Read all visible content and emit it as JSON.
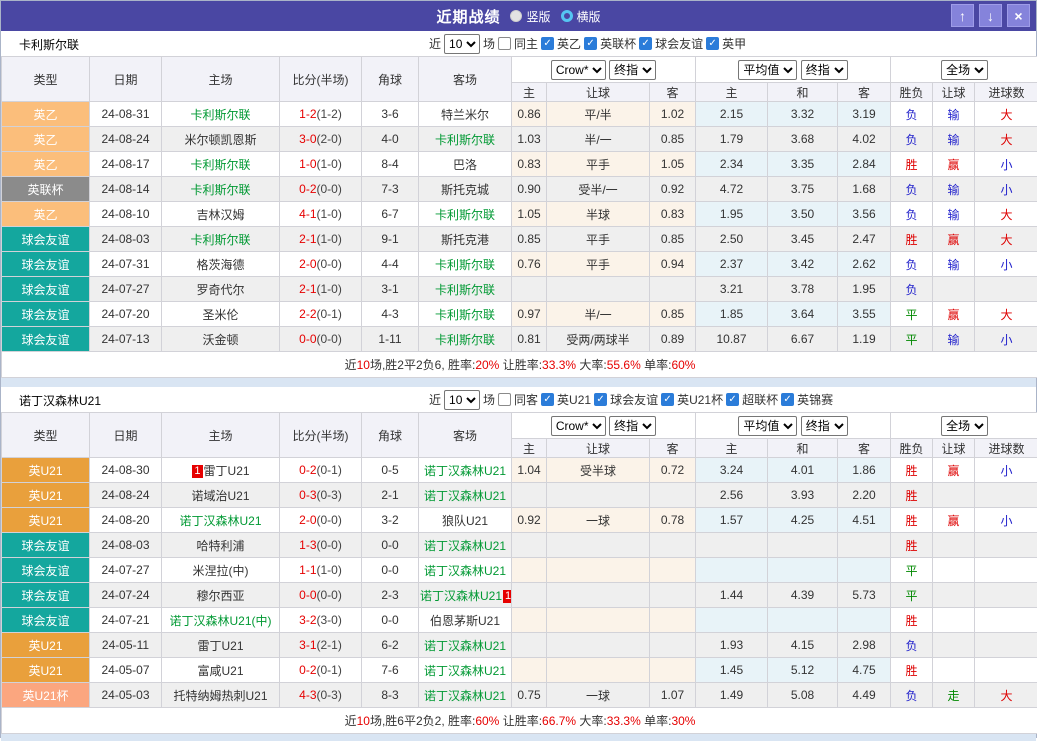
{
  "titlebar": {
    "title": "近期战绩",
    "vertical_label": "竖版",
    "horizontal_label": "横版",
    "up_glyph": "↑",
    "down_glyph": "↓",
    "close_glyph": "×"
  },
  "table_header": {
    "type": "类型",
    "date": "日期",
    "home": "主场",
    "score": "比分(半场)",
    "corner": "角球",
    "away": "客场",
    "odds_group": {
      "provider_dropdown": "Crow*",
      "time_dropdown": "终指",
      "sub": [
        "主",
        "让球",
        "客"
      ]
    },
    "avg_group": {
      "value_dropdown": "平均值",
      "time_dropdown": "终指",
      "sub": [
        "主",
        "和",
        "客"
      ]
    },
    "result_group": {
      "scope_dropdown": "全场",
      "sub": [
        "胜负",
        "让球",
        "进球数"
      ]
    }
  },
  "type_colors": {
    "英乙": "#fbbe7b",
    "英联杯": "#8b8b8b",
    "球会友谊": "#14a79e",
    "英U21": "#e9a03c",
    "英U21杯": "#fba67f"
  },
  "result_colors": {
    "胜": "#de0000",
    "赢": "#de0000",
    "大": "#de0000",
    "负": "#2222cc",
    "输": "#2222cc",
    "小": "#2222cc",
    "平": "#008800",
    "走": "#008800"
  },
  "sections": [
    {
      "team": "卡利斯尔联",
      "filter": {
        "near": "近",
        "count": "10",
        "games": "场",
        "same": "同主",
        "leagues": [
          "英乙",
          "英联杯",
          "球会友谊",
          "英甲"
        ]
      },
      "rows": [
        {
          "type": "英乙",
          "date": "24-08-31",
          "home": "卡利斯尔联",
          "hg": true,
          "score": "1-2",
          "half": "(1-2)",
          "corner": "3-6",
          "away": "特兰米尔",
          "ag": false,
          "o1": "0.86",
          "hc": "平/半",
          "o2": "1.02",
          "a1": "2.15",
          "a2": "3.32",
          "a3": "3.19",
          "r1": "负",
          "r2": "输",
          "r3": "大"
        },
        {
          "type": "英乙",
          "date": "24-08-24",
          "home": "米尔顿凯恩斯",
          "hg": false,
          "score": "3-0",
          "half": "(2-0)",
          "corner": "4-0",
          "away": "卡利斯尔联",
          "ag": true,
          "o1": "1.03",
          "hc": "半/一",
          "o2": "0.85",
          "a1": "1.79",
          "a2": "3.68",
          "a3": "4.02",
          "r1": "负",
          "r2": "输",
          "r3": "大"
        },
        {
          "type": "英乙",
          "date": "24-08-17",
          "home": "卡利斯尔联",
          "hg": true,
          "score": "1-0",
          "half": "(1-0)",
          "corner": "8-4",
          "away": "巴洛",
          "ag": false,
          "o1": "0.83",
          "hc": "平手",
          "o2": "1.05",
          "a1": "2.34",
          "a2": "3.35",
          "a3": "2.84",
          "r1": "胜",
          "r2": "赢",
          "r3": "小"
        },
        {
          "type": "英联杯",
          "date": "24-08-14",
          "home": "卡利斯尔联",
          "hg": true,
          "score": "0-2",
          "half": "(0-0)",
          "corner": "7-3",
          "away": "斯托克城",
          "ag": false,
          "o1": "0.90",
          "hc": "受半/一",
          "o2": "0.92",
          "a1": "4.72",
          "a2": "3.75",
          "a3": "1.68",
          "r1": "负",
          "r2": "输",
          "r3": "小"
        },
        {
          "type": "英乙",
          "date": "24-08-10",
          "home": "吉林汉姆",
          "hg": false,
          "score": "4-1",
          "half": "(1-0)",
          "corner": "6-7",
          "away": "卡利斯尔联",
          "ag": true,
          "o1": "1.05",
          "hc": "半球",
          "o2": "0.83",
          "a1": "1.95",
          "a2": "3.50",
          "a3": "3.56",
          "r1": "负",
          "r2": "输",
          "r3": "大"
        },
        {
          "type": "球会友谊",
          "date": "24-08-03",
          "home": "卡利斯尔联",
          "hg": true,
          "score": "2-1",
          "half": "(1-0)",
          "corner": "9-1",
          "away": "斯托克港",
          "ag": false,
          "o1": "0.85",
          "hc": "平手",
          "o2": "0.85",
          "a1": "2.50",
          "a2": "3.45",
          "a3": "2.47",
          "r1": "胜",
          "r2": "赢",
          "r3": "大"
        },
        {
          "type": "球会友谊",
          "date": "24-07-31",
          "home": "格茨海德",
          "hg": false,
          "score": "2-0",
          "half": "(0-0)",
          "corner": "4-4",
          "away": "卡利斯尔联",
          "ag": true,
          "o1": "0.76",
          "hc": "平手",
          "o2": "0.94",
          "a1": "2.37",
          "a2": "3.42",
          "a3": "2.62",
          "r1": "负",
          "r2": "输",
          "r3": "小"
        },
        {
          "type": "球会友谊",
          "date": "24-07-27",
          "home": "罗奇代尔",
          "hg": false,
          "score": "2-1",
          "half": "(1-0)",
          "corner": "3-1",
          "away": "卡利斯尔联",
          "ag": true,
          "o1": "",
          "hc": "",
          "o2": "",
          "a1": "3.21",
          "a2": "3.78",
          "a3": "1.95",
          "r1": "负",
          "r2": "",
          "r3": ""
        },
        {
          "type": "球会友谊",
          "date": "24-07-20",
          "home": "圣米伦",
          "hg": false,
          "score": "2-2",
          "half": "(0-1)",
          "corner": "4-3",
          "away": "卡利斯尔联",
          "ag": true,
          "o1": "0.97",
          "hc": "半/一",
          "o2": "0.85",
          "a1": "1.85",
          "a2": "3.64",
          "a3": "3.55",
          "r1": "平",
          "r2": "赢",
          "r3": "大"
        },
        {
          "type": "球会友谊",
          "date": "24-07-13",
          "home": "沃金顿",
          "hg": false,
          "score": "0-0",
          "half": "(0-0)",
          "corner": "1-11",
          "away": "卡利斯尔联",
          "ag": true,
          "o1": "0.81",
          "hc": "受两/两球半",
          "o2": "0.89",
          "a1": "10.87",
          "a2": "6.67",
          "a3": "1.19",
          "r1": "平",
          "r2": "输",
          "r3": "小"
        }
      ],
      "summary": [
        {
          "t": "近"
        },
        {
          "t": "10",
          "red": true
        },
        {
          "t": "场,胜2平2负6, 胜率:"
        },
        {
          "t": "20%",
          "red": true
        },
        {
          "t": " 让胜率:"
        },
        {
          "t": "33.3%",
          "red": true
        },
        {
          "t": " 大率:"
        },
        {
          "t": "55.6%",
          "red": true
        },
        {
          "t": " 单率:"
        },
        {
          "t": "60%",
          "red": true
        }
      ]
    },
    {
      "team": "诺丁汉森林U21",
      "filter": {
        "near": "近",
        "count": "10",
        "games": "场",
        "same": "同客",
        "leagues": [
          "英U21",
          "球会友谊",
          "英U21杯",
          "超联杯",
          "英锦赛"
        ]
      },
      "rows": [
        {
          "type": "英U21",
          "date": "24-08-30",
          "home": "雷丁U21",
          "hb": "1",
          "hg": false,
          "score": "0-2",
          "half": "(0-1)",
          "corner": "0-5",
          "away": "诺丁汉森林U21",
          "ag": true,
          "o1": "1.04",
          "hc": "受半球",
          "o2": "0.72",
          "a1": "3.24",
          "a2": "4.01",
          "a3": "1.86",
          "r1": "胜",
          "r2": "赢",
          "r3": "小"
        },
        {
          "type": "英U21",
          "date": "24-08-24",
          "home": "诺域治U21",
          "hg": false,
          "score": "0-3",
          "half": "(0-3)",
          "corner": "2-1",
          "away": "诺丁汉森林U21",
          "ag": true,
          "o1": "",
          "hc": "",
          "o2": "",
          "a1": "2.56",
          "a2": "3.93",
          "a3": "2.20",
          "r1": "胜",
          "r2": "",
          "r3": ""
        },
        {
          "type": "英U21",
          "date": "24-08-20",
          "home": "诺丁汉森林U21",
          "hg": true,
          "score": "2-0",
          "half": "(0-0)",
          "corner": "3-2",
          "away": "狼队U21",
          "ag": false,
          "o1": "0.92",
          "hc": "一球",
          "o2": "0.78",
          "a1": "1.57",
          "a2": "4.25",
          "a3": "4.51",
          "r1": "胜",
          "r2": "赢",
          "r3": "小"
        },
        {
          "type": "球会友谊",
          "date": "24-08-03",
          "home": "哈特利浦",
          "hg": false,
          "score": "1-3",
          "half": "(0-0)",
          "corner": "0-0",
          "away": "诺丁汉森林U21",
          "ag": true,
          "o1": "",
          "hc": "",
          "o2": "",
          "a1": "",
          "a2": "",
          "a3": "",
          "r1": "胜",
          "r2": "",
          "r3": ""
        },
        {
          "type": "球会友谊",
          "date": "24-07-27",
          "home": "米涅拉(中)",
          "hg": false,
          "score": "1-1",
          "half": "(1-0)",
          "corner": "0-0",
          "away": "诺丁汉森林U21",
          "ag": true,
          "o1": "",
          "hc": "",
          "o2": "",
          "a1": "",
          "a2": "",
          "a3": "",
          "r1": "平",
          "r2": "",
          "r3": ""
        },
        {
          "type": "球会友谊",
          "date": "24-07-24",
          "home": "穆尔西亚",
          "hg": false,
          "score": "0-0",
          "half": "(0-0)",
          "corner": "2-3",
          "away": "诺丁汉森林U21",
          "ab": "1",
          "ag": true,
          "o1": "",
          "hc": "",
          "o2": "",
          "a1": "1.44",
          "a2": "4.39",
          "a3": "5.73",
          "r1": "平",
          "r2": "",
          "r3": ""
        },
        {
          "type": "球会友谊",
          "date": "24-07-21",
          "home": "诺丁汉森林U21(中)",
          "hg": true,
          "score": "3-2",
          "half": "(3-0)",
          "corner": "0-0",
          "away": "伯恩茅斯U21",
          "ag": false,
          "o1": "",
          "hc": "",
          "o2": "",
          "a1": "",
          "a2": "",
          "a3": "",
          "r1": "胜",
          "r2": "",
          "r3": ""
        },
        {
          "type": "英U21",
          "date": "24-05-11",
          "home": "雷丁U21",
          "hg": false,
          "score": "3-1",
          "half": "(2-1)",
          "corner": "6-2",
          "away": "诺丁汉森林U21",
          "ag": true,
          "o1": "",
          "hc": "",
          "o2": "",
          "a1": "1.93",
          "a2": "4.15",
          "a3": "2.98",
          "r1": "负",
          "r2": "",
          "r3": ""
        },
        {
          "type": "英U21",
          "date": "24-05-07",
          "home": "富咸U21",
          "hg": false,
          "score": "0-2",
          "half": "(0-1)",
          "corner": "7-6",
          "away": "诺丁汉森林U21",
          "ag": true,
          "o1": "",
          "hc": "",
          "o2": "",
          "a1": "1.45",
          "a2": "5.12",
          "a3": "4.75",
          "r1": "胜",
          "r2": "",
          "r3": ""
        },
        {
          "type": "英U21杯",
          "date": "24-05-03",
          "home": "托特纳姆热刺U21",
          "hg": false,
          "score": "4-3",
          "half": "(0-3)",
          "corner": "8-3",
          "away": "诺丁汉森林U21",
          "ag": true,
          "o1": "0.75",
          "hc": "一球",
          "o2": "1.07",
          "a1": "1.49",
          "a2": "5.08",
          "a3": "4.49",
          "r1": "负",
          "r2": "走",
          "r3": "大"
        }
      ],
      "summary": [
        {
          "t": "近"
        },
        {
          "t": "10",
          "red": true
        },
        {
          "t": "场,胜6平2负2, 胜率:"
        },
        {
          "t": "60%",
          "red": true
        },
        {
          "t": " 让胜率:"
        },
        {
          "t": "66.7%",
          "red": true
        },
        {
          "t": " 大率:"
        },
        {
          "t": "33.3%",
          "red": true
        },
        {
          "t": " 单率:"
        },
        {
          "t": "30%",
          "red": true
        }
      ]
    }
  ]
}
